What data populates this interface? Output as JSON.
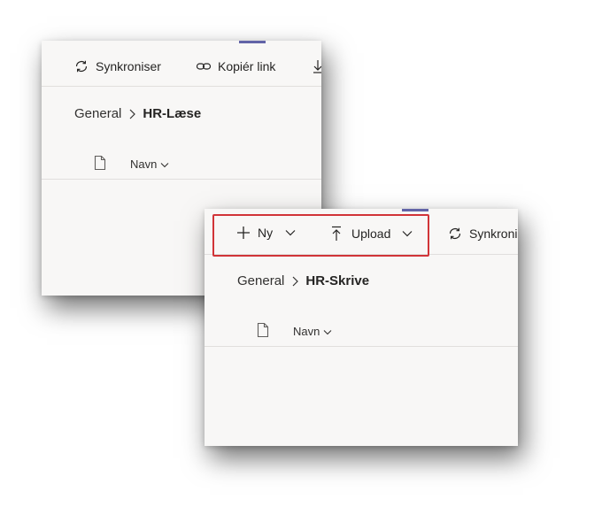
{
  "panel_read": {
    "toolbar": {
      "sync_label": "Synkroniser",
      "copy_link_label": "Kopiér link"
    },
    "breadcrumb": {
      "parent": "General",
      "current": "HR-Læse"
    },
    "column_header": {
      "name_label": "Navn"
    }
  },
  "panel_write": {
    "toolbar": {
      "new_label": "Ny",
      "upload_label": "Upload",
      "sync_label": "Synkroniser"
    },
    "breadcrumb": {
      "parent": "General",
      "current": "HR-Skrive"
    },
    "column_header": {
      "name_label": "Navn"
    }
  },
  "colors": {
    "accent": "#6264a7",
    "highlight": "#d13438",
    "panel_bg": "#f8f7f6"
  }
}
